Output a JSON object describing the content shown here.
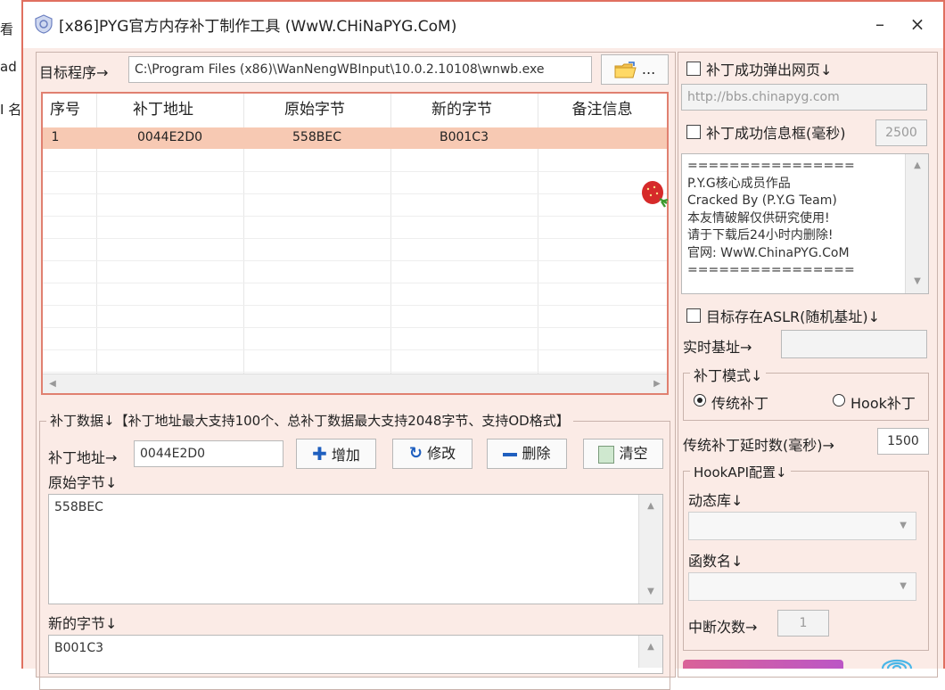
{
  "background": {
    "items": [
      "看",
      "ad",
      "I 名"
    ]
  },
  "window": {
    "title": "[x86]PYG官方内存补丁制作工具 (WwW.CHiNaPYG.CoM)",
    "minimize": "–",
    "close": "×",
    "accent_color": "#e07060",
    "row_highlight": "#f7c9b3"
  },
  "target": {
    "label": "目标程序→",
    "path": "C:\\Program Files (x86)\\WanNengWBInput\\10.0.2.10108\\wnwb.exe",
    "browse_label": "..."
  },
  "table": {
    "headers": [
      "序号",
      "补丁地址",
      "原始字节",
      "新的字节",
      "备注信息"
    ],
    "rows": [
      {
        "index": "1",
        "address": "0044E2D0",
        "original": "558BEC",
        "new": "B001C3",
        "note": ""
      }
    ]
  },
  "patch_data": {
    "legend": "补丁数据↓【补丁地址最大支持100个、总补丁数据最大支持2048字节、支持OD格式】",
    "address_label": "补丁地址→",
    "address_value": "0044E2D0",
    "add_label": "增加",
    "modify_label": "修改",
    "delete_label": "删除",
    "clear_label": "清空",
    "original_label": "原始字节↓",
    "original_value": "558BEC",
    "new_label": "新的字节↓",
    "new_value": "B001C3"
  },
  "options": {
    "popup_web_label": "补丁成功弹出网页↓",
    "popup_web_url": "http://bbs.chinapyg.com",
    "msgbox_label": "补丁成功信息框(毫秒)",
    "msgbox_ms": "2500",
    "message_lines": [
      "================",
      "P.Y.G核心成员作品",
      "Cracked By (P.Y.G Team)",
      "本友情破解仅供研究使用!",
      "请于下载后24小时内删除!",
      "官网: WwW.ChinaPYG.CoM",
      "================"
    ],
    "aslr_label": "目标存在ASLR(随机基址)↓",
    "realtime_base_label": "实时基址→",
    "realtime_base_value": "",
    "mode_legend": "补丁模式↓",
    "mode_traditional": "传统补丁",
    "mode_hook": "Hook补丁",
    "delay_label": "传统补丁延时数(毫秒)→",
    "delay_value": "1500",
    "hookapi_legend": "HookAPI配置↓",
    "dll_label": "动态库↓",
    "func_label": "函数名↓",
    "break_count_label": "中断次数→",
    "break_count_value": "1"
  }
}
